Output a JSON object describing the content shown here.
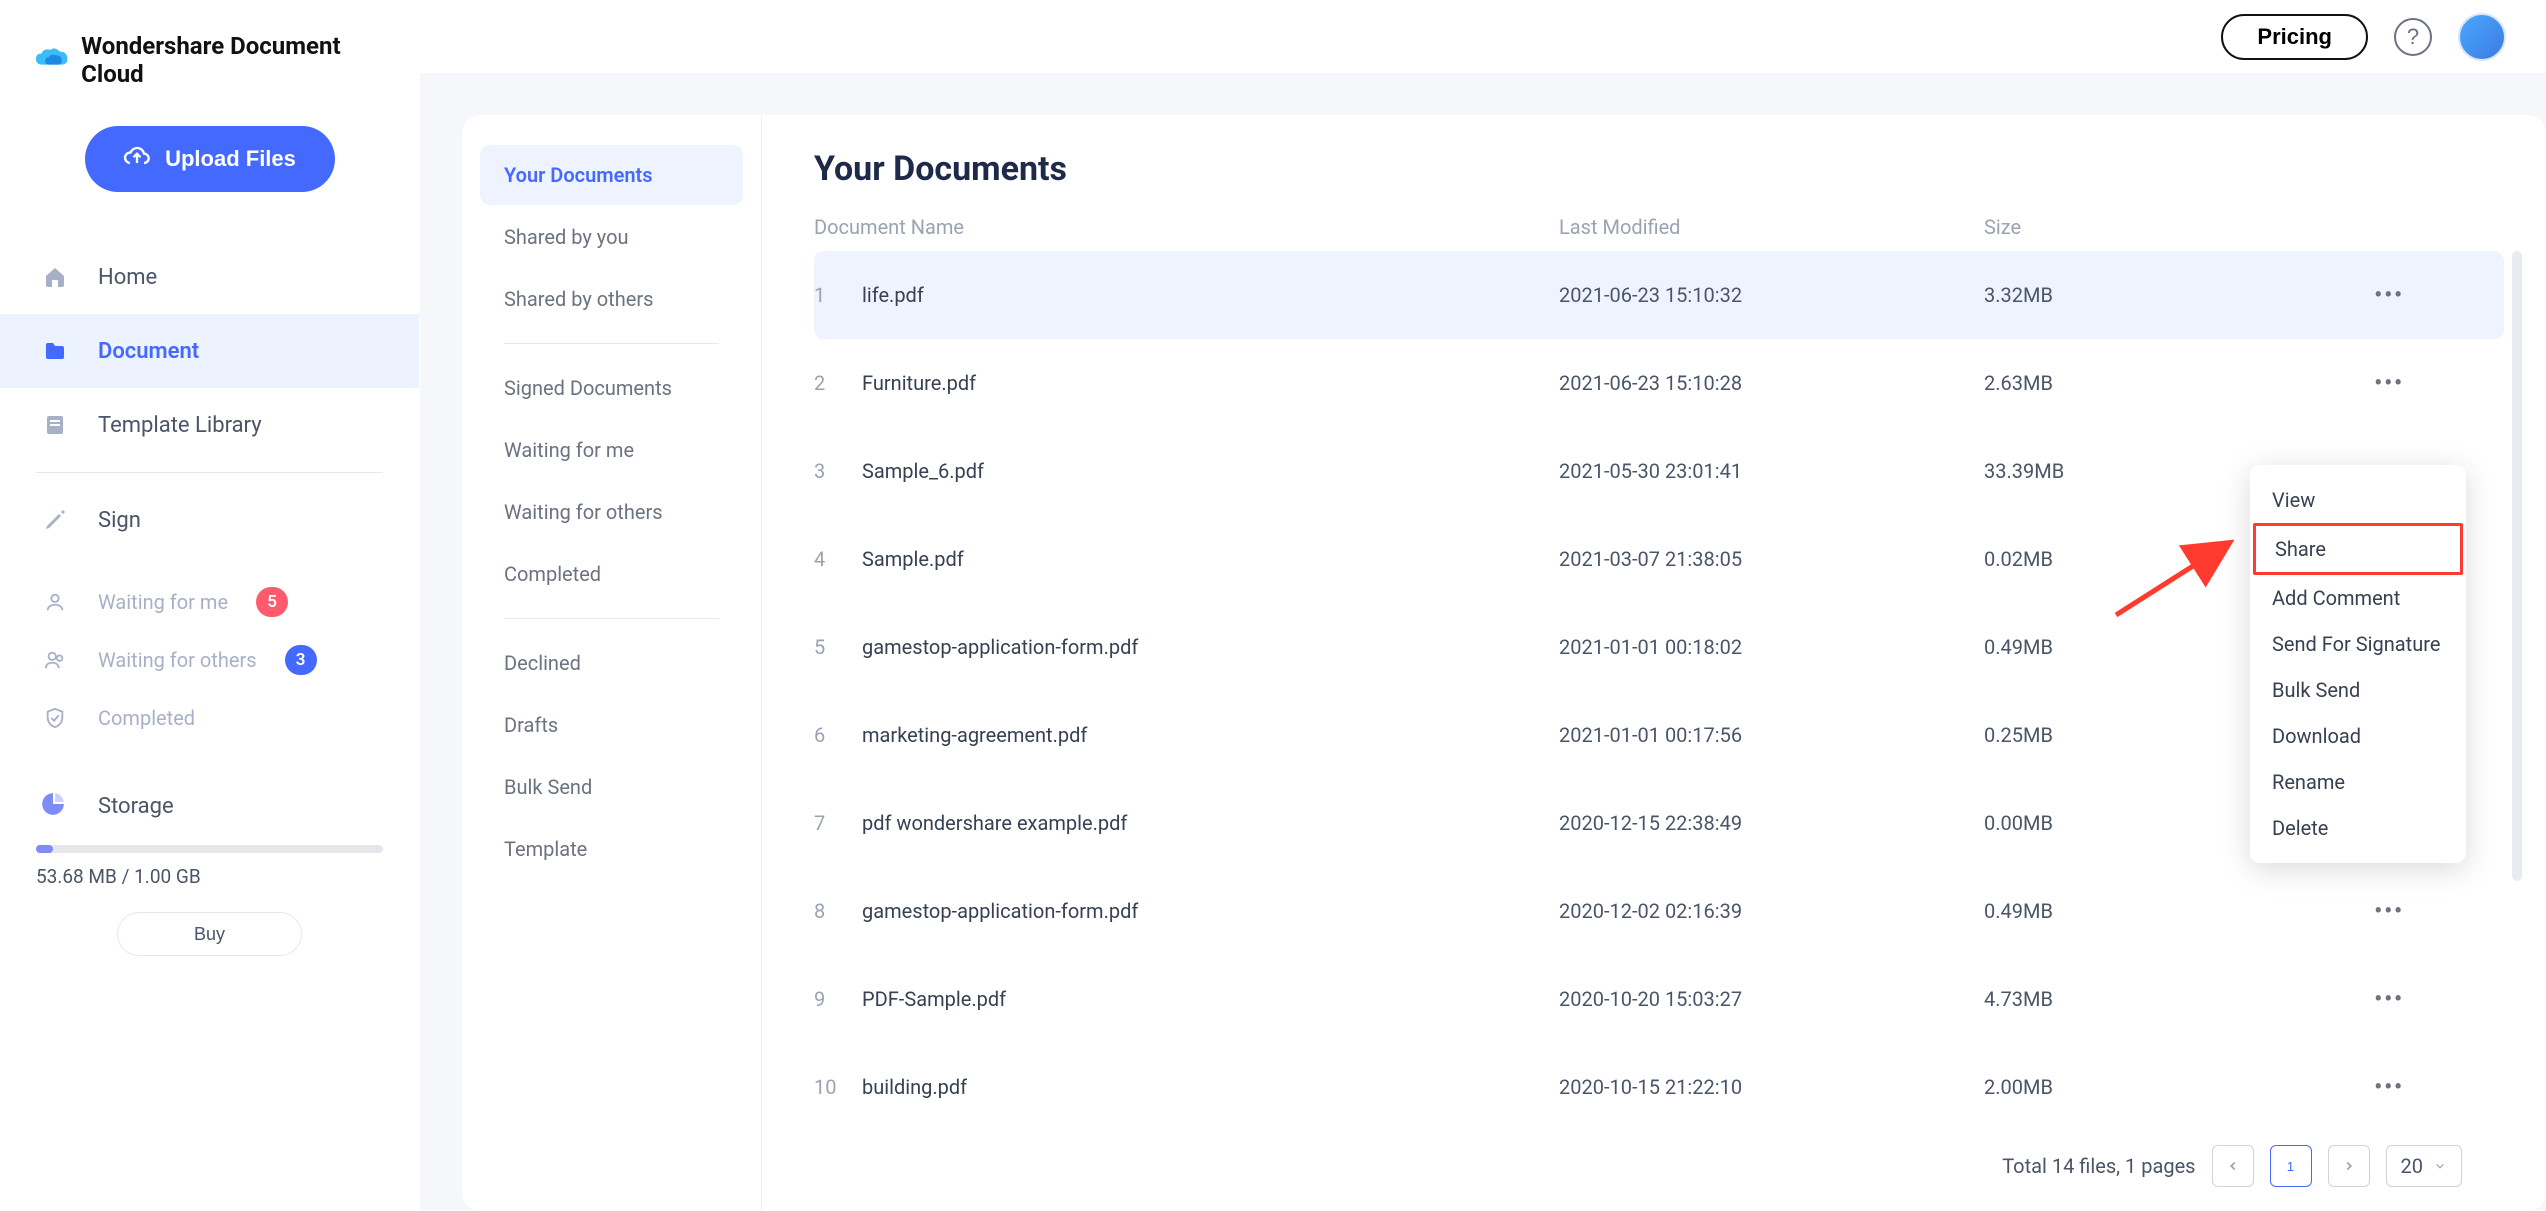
{
  "brand": "Wondershare Document Cloud",
  "upload_label": "Upload Files",
  "nav": {
    "home": "Home",
    "document": "Document",
    "template": "Template Library",
    "sign": "Sign",
    "waiting_me": "Waiting for me",
    "waiting_me_count": "5",
    "waiting_others": "Waiting for others",
    "waiting_others_count": "3",
    "completed": "Completed"
  },
  "storage": {
    "label": "Storage",
    "text": "53.68 MB / 1.00 GB",
    "buy": "Buy"
  },
  "topbar": {
    "pricing": "Pricing",
    "help": "?"
  },
  "sub_sidebar": {
    "your_documents": "Your Documents",
    "shared_by_you": "Shared by you",
    "shared_by_others": "Shared by others",
    "signed_documents": "Signed Documents",
    "waiting_for_me": "Waiting for me",
    "waiting_for_others": "Waiting for others",
    "completed": "Completed",
    "declined": "Declined",
    "drafts": "Drafts",
    "bulk_send": "Bulk Send",
    "template": "Template"
  },
  "page": {
    "title": "Your Documents",
    "col_name": "Document Name",
    "col_date": "Last Modified",
    "col_size": "Size"
  },
  "rows": [
    {
      "idx": "1",
      "name": "life.pdf",
      "date": "2021-06-23 15:10:32",
      "size": "3.32MB"
    },
    {
      "idx": "2",
      "name": "Furniture.pdf",
      "date": "2021-06-23 15:10:28",
      "size": "2.63MB"
    },
    {
      "idx": "3",
      "name": "Sample_6.pdf",
      "date": "2021-05-30 23:01:41",
      "size": "33.39MB"
    },
    {
      "idx": "4",
      "name": "Sample.pdf",
      "date": "2021-03-07 21:38:05",
      "size": "0.02MB"
    },
    {
      "idx": "5",
      "name": "gamestop-application-form.pdf",
      "date": "2021-01-01 00:18:02",
      "size": "0.49MB"
    },
    {
      "idx": "6",
      "name": "marketing-agreement.pdf",
      "date": "2021-01-01 00:17:56",
      "size": "0.25MB"
    },
    {
      "idx": "7",
      "name": "pdf wondershare example.pdf",
      "date": "2020-12-15 22:38:49",
      "size": "0.00MB"
    },
    {
      "idx": "8",
      "name": "gamestop-application-form.pdf",
      "date": "2020-12-02 02:16:39",
      "size": "0.49MB"
    },
    {
      "idx": "9",
      "name": "PDF-Sample.pdf",
      "date": "2020-10-20 15:03:27",
      "size": "4.73MB"
    },
    {
      "idx": "10",
      "name": "building.pdf",
      "date": "2020-10-15 21:22:10",
      "size": "2.00MB"
    }
  ],
  "footer": {
    "total": "Total 14 files, 1 pages",
    "page": "1",
    "page_size": "20"
  },
  "context_menu": {
    "view": "View",
    "share": "Share",
    "add_comment": "Add Comment",
    "send_signature": "Send For Signature",
    "bulk_send": "Bulk Send",
    "download": "Download",
    "rename": "Rename",
    "delete": "Delete"
  }
}
